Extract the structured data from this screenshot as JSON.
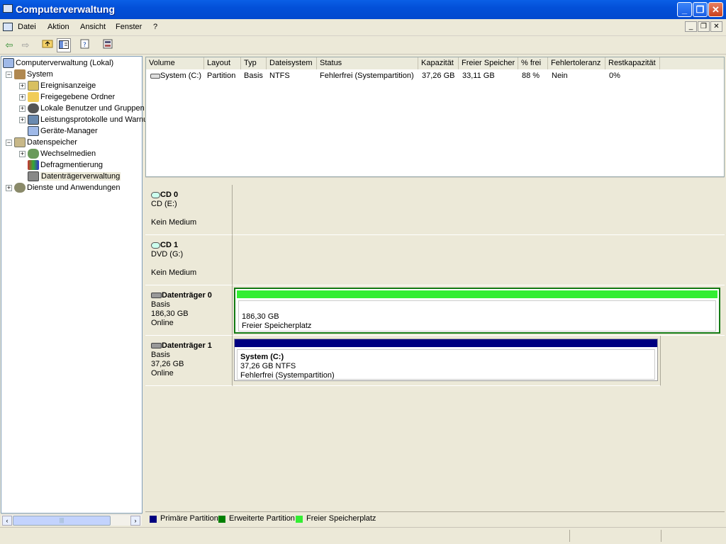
{
  "window": {
    "title": "Computerverwaltung",
    "min_symbol": "_",
    "max_symbol": "❐",
    "close_symbol": "✕"
  },
  "menu": {
    "items": [
      "Datei",
      "Aktion",
      "Ansicht",
      "Fenster",
      "?"
    ]
  },
  "tree": {
    "root": "Computerverwaltung (Lokal)",
    "system": "System",
    "ereignisanzeige": "Ereignisanzeige",
    "freigegebene_ordner": "Freigegebene Ordner",
    "lokale_benutzer": "Lokale Benutzer und Gruppen",
    "leistungsprotokolle": "Leistungsprotokolle und Warnungen",
    "geraete_manager": "Geräte-Manager",
    "datenspeicher": "Datenspeicher",
    "wechselmedien": "Wechselmedien",
    "defragmentierung": "Defragmentierung",
    "datentraegerverwaltung": "Datenträgerverwaltung",
    "dienste": "Dienste und Anwendungen",
    "scroll_thumb_grip": "|||"
  },
  "volumes": {
    "columns": [
      "Volume",
      "Layout",
      "Typ",
      "Dateisystem",
      "Status",
      "Kapazität",
      "Freier Speicher",
      "% frei",
      "Fehlertoleranz",
      "Restkapazität"
    ],
    "rows": [
      [
        "System (C:)",
        "Partition",
        "Basis",
        "NTFS",
        "Fehlerfrei (Systempartition)",
        "37,26 GB",
        "33,11 GB",
        "88 %",
        "Nein",
        "0%"
      ]
    ]
  },
  "disks": {
    "cd0": {
      "name": "CD 0",
      "drive": "CD (E:)",
      "media": "Kein Medium"
    },
    "cd1": {
      "name": "CD 1",
      "drive": "DVD (G:)",
      "media": "Kein Medium"
    },
    "disk0": {
      "name": "Datenträger 0",
      "type": "Basis",
      "size": "186,30 GB",
      "state": "Online",
      "part_size": "186,30 GB",
      "part_desc": "Freier Speicherplatz"
    },
    "disk1": {
      "name": "Datenträger 1",
      "type": "Basis",
      "size": "37,26 GB",
      "state": "Online",
      "part_name": "System  (C:)",
      "part_size": "37,26 GB NTFS",
      "part_status": "Fehlerfrei (Systempartition)"
    }
  },
  "legend": {
    "primary": "Primäre Partition",
    "extended": "Erweiterte Partition",
    "free": "Freier Speicherplatz"
  },
  "colors": {
    "primary": "#000080",
    "extended": "#008000",
    "free": "#33ee33",
    "titlebar": "#0350d8"
  }
}
